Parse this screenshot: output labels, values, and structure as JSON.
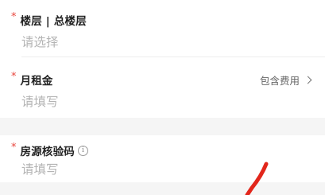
{
  "fields": {
    "floor": {
      "required_mark": "*",
      "label": "楼层 | 总楼层",
      "placeholder": "请选择"
    },
    "monthly_rent": {
      "required_mark": "*",
      "label": "月租金",
      "placeholder": "请填写",
      "accessory_label": "包含费用"
    },
    "verification_code": {
      "required_mark": "*",
      "label": "房源核验码",
      "placeholder": "请填写",
      "info_glyph": "i"
    }
  },
  "colors": {
    "required": "#e8463e",
    "label": "#222222",
    "placeholder": "#b4b4b4",
    "annotation": "#e2261b",
    "section_gap": "#f5f5f5"
  },
  "icons": {
    "chevron": "chevron-right-icon",
    "info": "info-circle-icon",
    "annotation": "red-arrow-annotation"
  }
}
